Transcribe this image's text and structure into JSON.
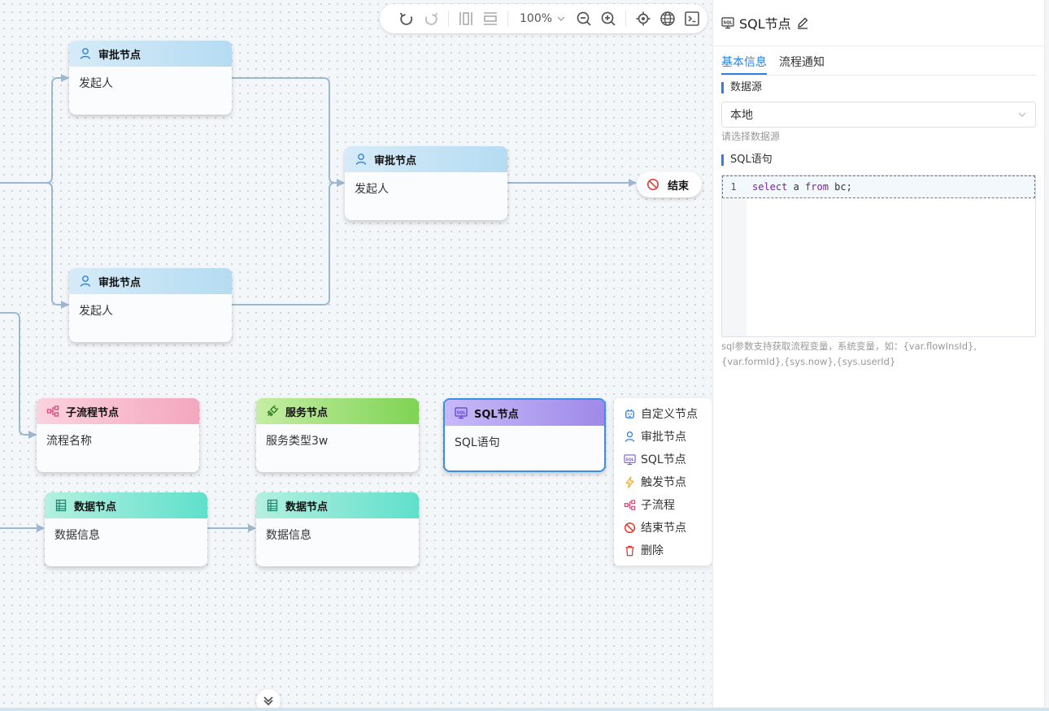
{
  "toolbar": {
    "zoom_level": "100%",
    "icons": [
      "undo-icon",
      "redo-icon",
      "align-vertical-icon",
      "align-horizontal-icon",
      "zoom-out-icon",
      "zoom-in-icon",
      "locate-icon",
      "globe-icon",
      "terminal-icon"
    ]
  },
  "nodes": {
    "approval_top": {
      "title": "审批节点",
      "body": "发起人"
    },
    "approval_mid": {
      "title": "审批节点",
      "body": "发起人"
    },
    "approval_bottom": {
      "title": "审批节点",
      "body": "发起人"
    },
    "end": {
      "title": "结束"
    },
    "subflow": {
      "title": "子流程节点",
      "body": "流程名称"
    },
    "service": {
      "title": "服务节点",
      "body": "服务类型3w"
    },
    "sql": {
      "title": "SQL节点",
      "body": "SQL语句"
    },
    "data_left": {
      "title": "数据节点",
      "body": "数据信息"
    },
    "data_right": {
      "title": "数据节点",
      "body": "数据信息"
    }
  },
  "context_menu": {
    "items": [
      {
        "label": "自定义节点",
        "icon": "robot-icon",
        "color": "#2f80e0"
      },
      {
        "label": "审批节点",
        "icon": "user-icon",
        "color": "#2f80e0"
      },
      {
        "label": "SQL节点",
        "icon": "sql-icon",
        "color": "#7b5be0"
      },
      {
        "label": "触发节点",
        "icon": "lightning-icon",
        "color": "#f5a623"
      },
      {
        "label": "子流程",
        "icon": "subflow-icon",
        "color": "#e0457b"
      },
      {
        "label": "结束节点",
        "icon": "stop-icon",
        "color": "#e53935"
      },
      {
        "label": "删除",
        "icon": "trash-icon",
        "color": "#e53935"
      }
    ]
  },
  "panel": {
    "title": "SQL节点",
    "tabs": [
      "基本信息",
      "流程通知"
    ],
    "active_tab": "基本信息",
    "datasource_label": "数据源",
    "datasource_value": "本地",
    "datasource_hint": "请选择数据源",
    "sql_label": "SQL语句",
    "editor_line_no": "1",
    "editor_code": {
      "kw1": "select",
      "t1": " a ",
      "kw2": "from",
      "t2": " bc;"
    },
    "note": "sql参数支持获取流程变量，系统变量，如：{var.flowInsId},{var.formId},{sys.now},{sys.userId}"
  },
  "colors": {
    "accent": "#2f80e0",
    "edge": "#9db6d2"
  }
}
